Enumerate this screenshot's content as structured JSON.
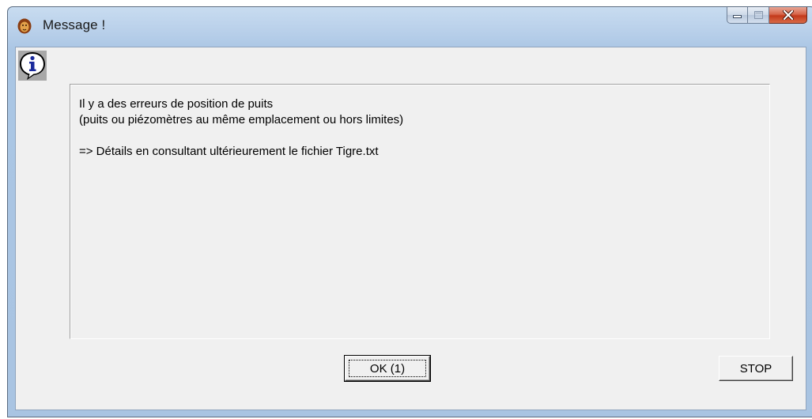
{
  "window": {
    "title": "Message !",
    "app_icon": "lion-head-icon",
    "caption_buttons": [
      "minimize-icon",
      "maximize-icon",
      "close-icon"
    ]
  },
  "dialog": {
    "icon": "info-icon",
    "message_lines": [
      "Il y a des erreurs de position de puits",
      "(puits ou piézomètres au même emplacement ou hors limites)",
      "",
      "=> Détails en consultant ultérieurement le fichier Tigre.txt"
    ]
  },
  "buttons": {
    "ok_label": "OK (1)",
    "stop_label": "STOP"
  },
  "colors": {
    "title_gradient": "#b9d0ea",
    "dialog_bg": "#f0f0f0",
    "close_red": "#c3391a"
  }
}
